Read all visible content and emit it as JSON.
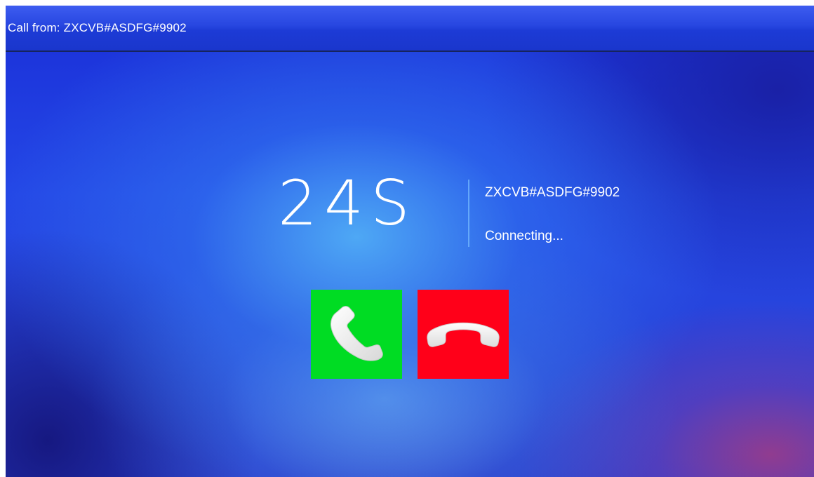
{
  "titlebar": {
    "title": "Call from: ZXCVB#ASDFG#9902"
  },
  "call": {
    "timer": "24S",
    "caller_id": "ZXCVB#ASDFG#9902",
    "status": "Connecting..."
  },
  "buttons": {
    "answer": {
      "icon": "phone-answer-icon",
      "color": "#00dc23"
    },
    "hangup": {
      "icon": "phone-hangup-icon",
      "color": "#ff0019"
    }
  },
  "colors": {
    "background": "#2447e6",
    "titlebar": "#2746e0",
    "text": "#ffffff"
  }
}
